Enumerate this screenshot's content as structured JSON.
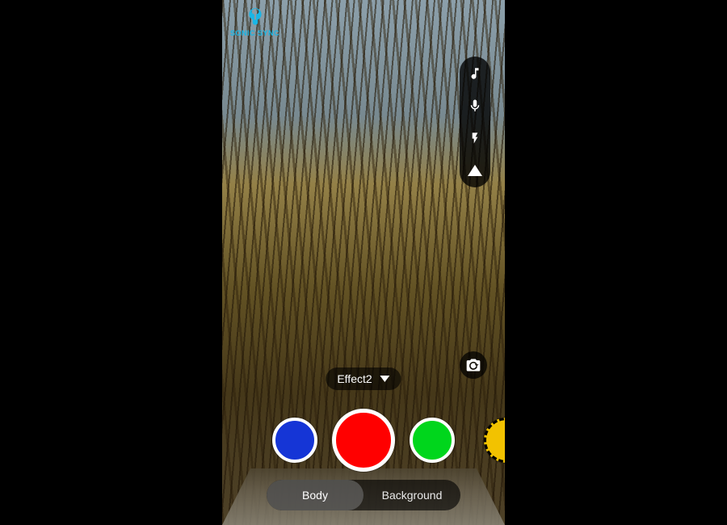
{
  "logo": {
    "text": "SONIC SYNC",
    "accent": "#19b6e6"
  },
  "toolbar": {
    "items": [
      {
        "name": "music-note-icon"
      },
      {
        "name": "microphone-icon"
      },
      {
        "name": "flash-icon"
      },
      {
        "name": "collapse-up-icon"
      }
    ]
  },
  "switch_camera": {
    "name": "switch-camera-button"
  },
  "effect_selector": {
    "label": "Effect2"
  },
  "colors": {
    "left": {
      "hex": "#1535d6"
    },
    "center": {
      "hex": "#ff0000"
    },
    "right": {
      "hex": "#00d61c"
    },
    "edge": {
      "hex": "#f2c200"
    }
  },
  "segments": {
    "body": "Body",
    "background": "Background",
    "active": "body"
  }
}
